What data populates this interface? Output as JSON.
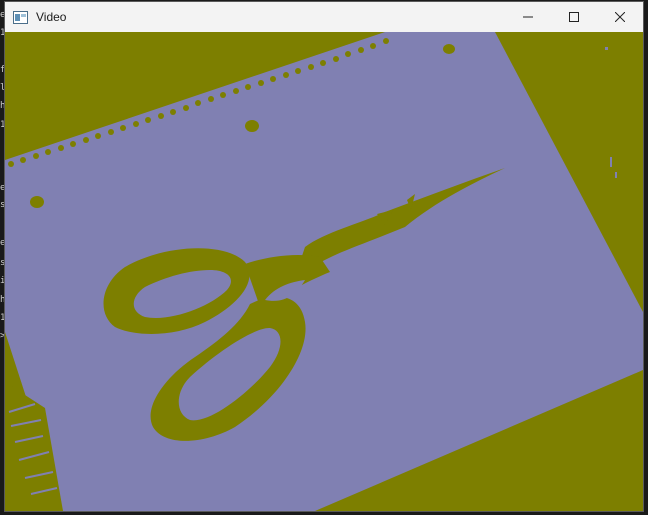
{
  "window": {
    "title": "Video",
    "icon": "app-window-icon",
    "controls": {
      "minimize_icon": "minimize-icon",
      "maximize_icon": "maximize-icon",
      "close_icon": "close-icon"
    }
  },
  "terminal_glyphs": [
    "e",
    "1",
    "f",
    "l",
    "h",
    "1",
    "e",
    "s",
    "e",
    "s",
    "i",
    "h",
    "1",
    ">"
  ],
  "colors": {
    "titlebar": "#f3f3f3",
    "paper": "#8080b2",
    "background": "#7d7f00"
  }
}
